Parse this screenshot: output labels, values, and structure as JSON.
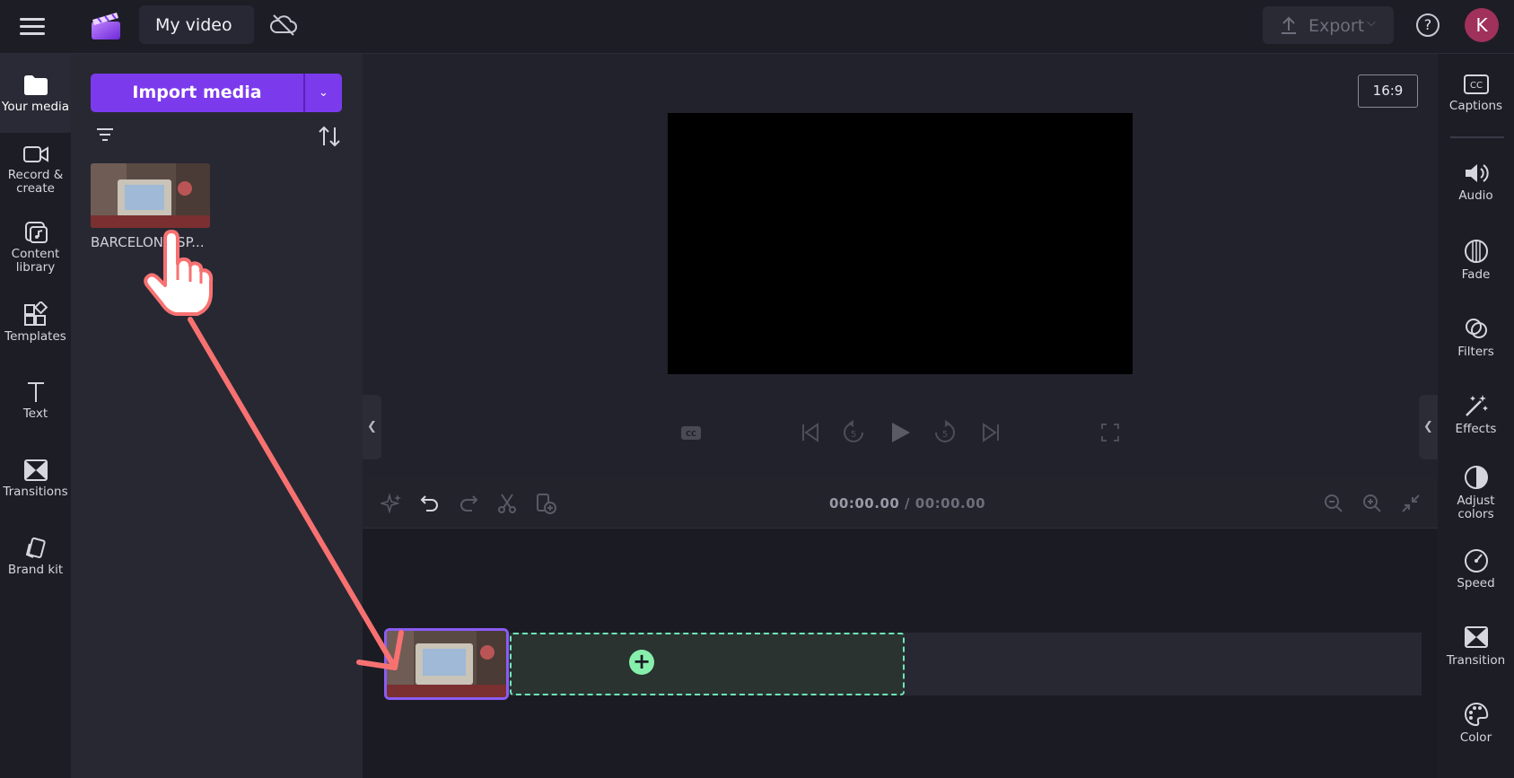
{
  "header": {
    "menu_icon": "hamburger-menu-icon",
    "logo_icon": "clipchamp-logo-icon",
    "project_title": "My video",
    "sync_icon": "cloud-off-icon",
    "export_label": "Export",
    "help_label": "?",
    "avatar_initial": "K"
  },
  "left_nav": {
    "items": [
      {
        "label": "Your media",
        "icon": "folder-icon",
        "active": true
      },
      {
        "label": "Record & create",
        "icon": "camera-icon"
      },
      {
        "label": "Content library",
        "icon": "content-library-icon"
      },
      {
        "label": "Templates",
        "icon": "templates-icon"
      },
      {
        "label": "Text",
        "icon": "text-icon"
      },
      {
        "label": "Transitions",
        "icon": "transitions-icon"
      },
      {
        "label": "Brand kit",
        "icon": "brand-kit-icon"
      }
    ]
  },
  "media_panel": {
    "import_label": "Import media",
    "items": [
      {
        "name": "BARCELONA SP...",
        "thumbnail": "retro-computer-scene"
      }
    ]
  },
  "preview": {
    "aspect_ratio": "16:9",
    "canvas_color": "#000000"
  },
  "timeline": {
    "current_time": "00:00.00",
    "separator": " / ",
    "total_time": "00:00.00"
  },
  "right_nav": {
    "items": [
      {
        "label": "Captions",
        "icon": "captions-icon"
      },
      {
        "label": "Audio",
        "icon": "speaker-icon"
      },
      {
        "label": "Fade",
        "icon": "fade-icon"
      },
      {
        "label": "Filters",
        "icon": "filters-icon"
      },
      {
        "label": "Effects",
        "icon": "magic-wand-icon"
      },
      {
        "label": "Adjust colors",
        "icon": "adjust-colors-icon"
      },
      {
        "label": "Speed",
        "icon": "speedometer-icon"
      },
      {
        "label": "Transition",
        "icon": "transition-icon"
      },
      {
        "label": "Color",
        "icon": "palette-icon"
      }
    ]
  },
  "colors": {
    "accent": "#7c3aed",
    "clip_border": "#8b5cf6",
    "dropzone": "#6ee7b7",
    "annotation_arrow": "#f87171",
    "avatar": "#a0315a"
  }
}
